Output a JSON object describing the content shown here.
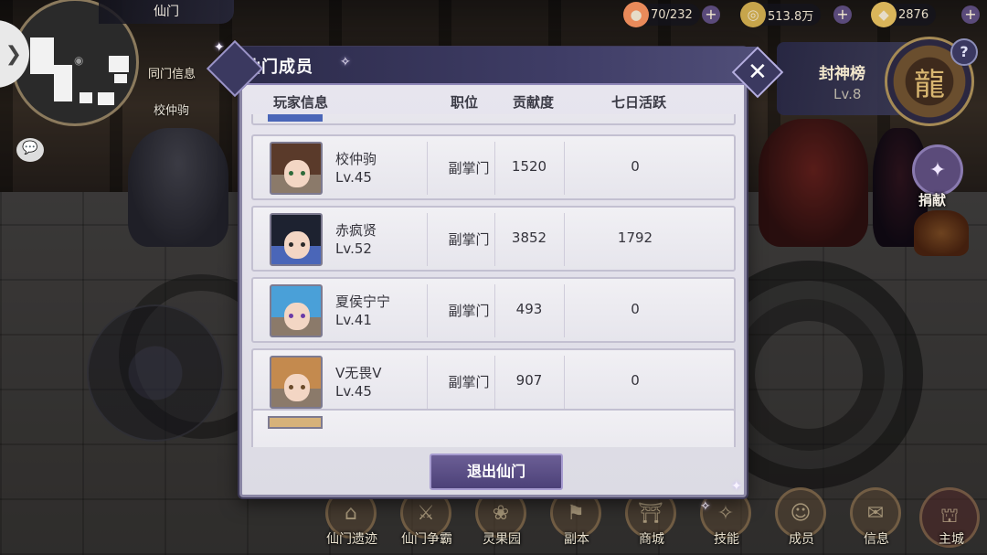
{
  "hud": {
    "sect_name": "仙门",
    "map_link": "同门信息",
    "npc_name": "校仲驹",
    "chat_icon": "chat-bubble-icon",
    "currencies": [
      {
        "name": "peach",
        "value": "70/232",
        "icon": "peach-icon",
        "color": "#e98a5a"
      },
      {
        "name": "coin",
        "value": "513.8万",
        "icon": "coin-icon",
        "color": "#c7a54b"
      },
      {
        "name": "ingot",
        "value": "2876",
        "icon": "ingot-icon",
        "color": "#d9b55a"
      }
    ],
    "rank_title": "封神榜",
    "rank_level": "Lv.8",
    "donate_label": "捐献"
  },
  "modal": {
    "title": "仙门成员",
    "columns": [
      "玩家信息",
      "职位",
      "贡献度",
      "七日活跃"
    ],
    "members": [
      {
        "name": "校仲驹",
        "level": "Lv.45",
        "position": "副掌门",
        "contribution": "1520",
        "activity": "0",
        "hair": "#5a3a2a",
        "eye": "#2e6a3a",
        "frame": "#8b7a6a"
      },
      {
        "name": "赤疯贤",
        "level": "Lv.52",
        "position": "副掌门",
        "contribution": "3852",
        "activity": "1792",
        "hair": "#1d2230",
        "eye": "#2a2a2a",
        "frame": "#4a66b8"
      },
      {
        "name": "夏侯宁宁",
        "level": "Lv.41",
        "position": "副掌门",
        "contribution": "493",
        "activity": "0",
        "hair": "#4aa0d8",
        "eye": "#6a3aa8",
        "frame": "#8b7a6a"
      },
      {
        "name": "V无畏V",
        "level": "Lv.45",
        "position": "副掌门",
        "contribution": "907",
        "activity": "0",
        "hair": "#c48a4e",
        "eye": "#6a4a2a",
        "frame": "#8b7a6a"
      }
    ],
    "exit_label": "退出仙门"
  },
  "bottom_nav": [
    {
      "label": "仙门遗迹",
      "icon": "ruins-icon"
    },
    {
      "label": "仙门争霸",
      "icon": "crossed-swords-icon"
    },
    {
      "label": "灵果园",
      "icon": "orchard-icon"
    },
    {
      "label": "副本",
      "icon": "dungeon-icon"
    },
    {
      "label": "商城",
      "icon": "shop-icon"
    },
    {
      "label": "技能",
      "icon": "skill-icon"
    },
    {
      "label": "成员",
      "icon": "members-icon"
    },
    {
      "label": "信息",
      "icon": "scroll-icon"
    },
    {
      "label": "主城",
      "icon": "palace-icon"
    }
  ]
}
